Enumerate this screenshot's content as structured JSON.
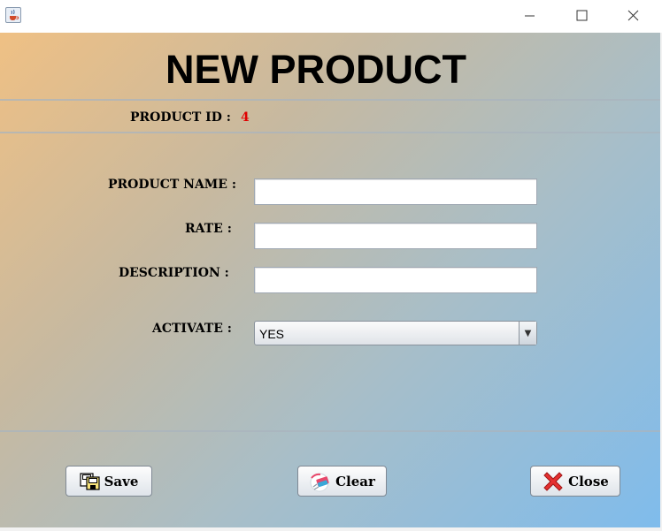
{
  "window": {
    "minimize_glyph": "—",
    "maximize_glyph": "☐",
    "close_glyph": "✕"
  },
  "form": {
    "heading": "NEW PRODUCT",
    "product_id_label": "PRODUCT ID :",
    "product_id_value": "4",
    "product_name_label": "PRODUCT NAME :",
    "product_name_value": "",
    "rate_label": "RATE :",
    "rate_value": "",
    "description_label": "DESCRIPTION :",
    "description_value": "",
    "activate_label": "ACTIVATE :",
    "activate_value": "YES",
    "activate_arrow": "▼"
  },
  "buttons": {
    "save_label": "Save",
    "clear_label": "Clear",
    "close_label": "Close"
  },
  "colors": {
    "id_value": "#e00000",
    "gradient_start": "#efc084",
    "gradient_end": "#7fbcec"
  },
  "icons": {
    "app": "java-app-icon",
    "save": "save-icon",
    "clear": "clear-icon",
    "close": "close-x-icon"
  }
}
